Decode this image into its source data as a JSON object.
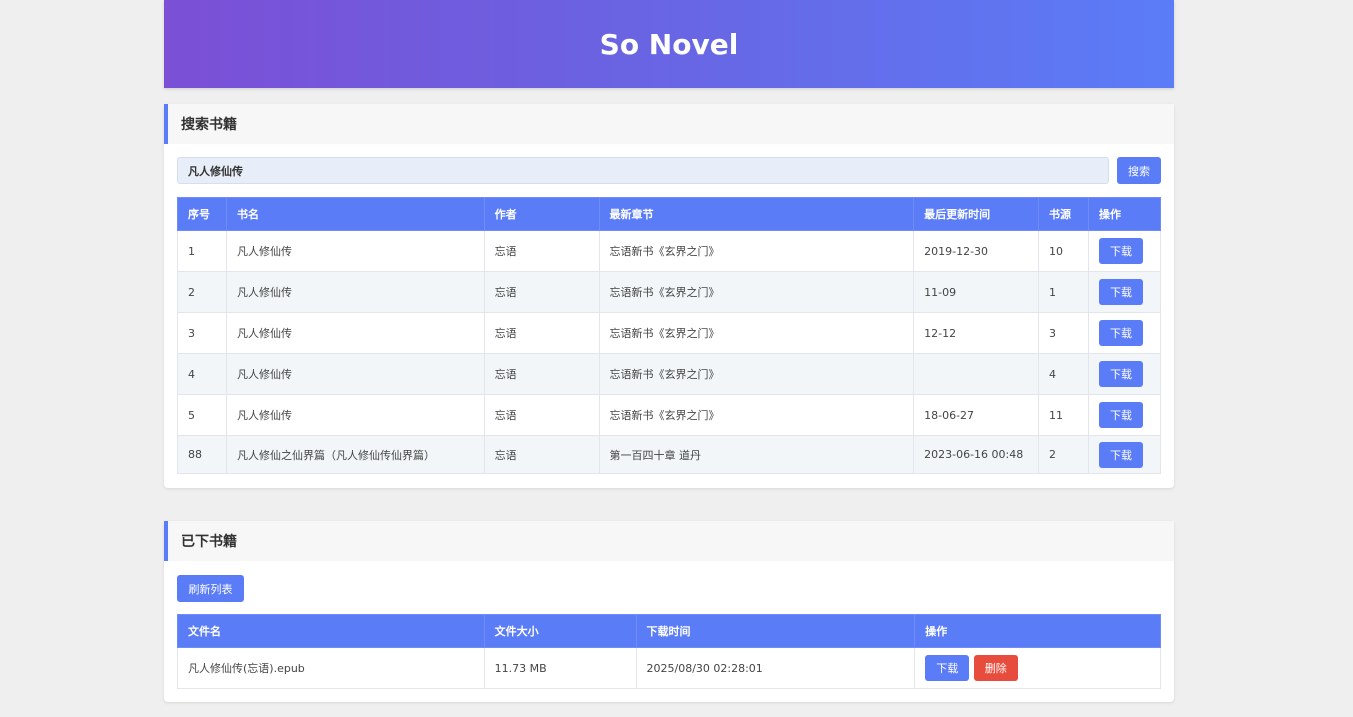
{
  "header": {
    "title": "So Novel"
  },
  "search": {
    "section_title": "搜索书籍",
    "query": "凡人修仙传",
    "button_label": "搜索",
    "columns": [
      "序号",
      "书名",
      "作者",
      "最新章节",
      "最后更新时间",
      "书源",
      "操作"
    ],
    "rows": [
      {
        "index": "1",
        "title": "凡人修仙传",
        "author": "忘语",
        "latest": "忘语新书《玄界之门》",
        "updated": "2019-12-30",
        "sources": "10",
        "action": "下载"
      },
      {
        "index": "2",
        "title": "凡人修仙传",
        "author": "忘语",
        "latest": "忘语新书《玄界之门》",
        "updated": "11-09",
        "sources": "1",
        "action": "下载"
      },
      {
        "index": "3",
        "title": "凡人修仙传",
        "author": "忘语",
        "latest": "忘语新书《玄界之门》",
        "updated": "12-12",
        "sources": "3",
        "action": "下载"
      },
      {
        "index": "4",
        "title": "凡人修仙传",
        "author": "忘语",
        "latest": "忘语新书《玄界之门》",
        "updated": "",
        "sources": "4",
        "action": "下载"
      },
      {
        "index": "5",
        "title": "凡人修仙传",
        "author": "忘语",
        "latest": "忘语新书《玄界之门》",
        "updated": "18-06-27",
        "sources": "11",
        "action": "下载"
      },
      {
        "index": "88",
        "title": "凡人修仙之仙界篇（凡人修仙传仙界篇）",
        "author": "忘语",
        "latest": "第一百四十章 道丹",
        "updated": "2023-06-16 00:48",
        "sources": "2",
        "action": "下载"
      }
    ]
  },
  "downloads": {
    "section_title": "已下书籍",
    "refresh_label": "刷新列表",
    "columns": [
      "文件名",
      "文件大小",
      "下载时间",
      "操作"
    ],
    "rows": [
      {
        "filename": "凡人修仙传(忘语).epub",
        "size": "11.73 MB",
        "time": "2025/08/30 02:28:01",
        "download": "下载",
        "delete": "删除"
      }
    ]
  },
  "colors": {
    "accent": "#5b7cf7",
    "danger": "#e74c3c",
    "gradient_start": "#7b4fd6"
  }
}
